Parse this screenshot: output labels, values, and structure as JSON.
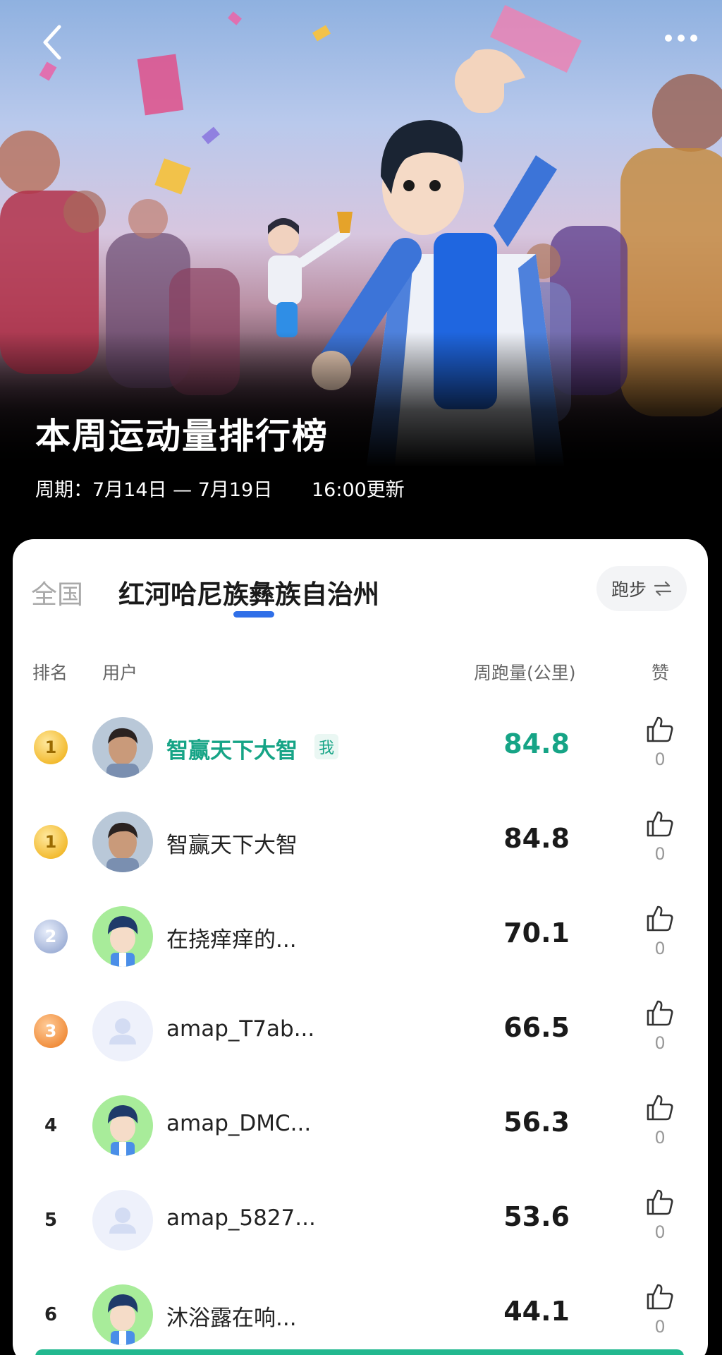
{
  "hero": {
    "title": "本周运动量排行榜",
    "period": "周期：7月14日 — 7月19日",
    "update": "16:00更新"
  },
  "tabs": {
    "national": "全国",
    "region": "红河哈尼族彝族自治州"
  },
  "sport_toggle": {
    "label": "跑步",
    "icon": "swap-arrows-icon"
  },
  "columns": {
    "rank": "排名",
    "user": "用户",
    "distance": "周跑量(公里)",
    "likes": "赞"
  },
  "me_tag": "我",
  "rows": [
    {
      "rank": "1",
      "name": "智赢天下大智",
      "distance": "84.8",
      "likes": "0"
    },
    {
      "rank": "1",
      "name": "智赢天下大智",
      "distance": "84.8",
      "likes": "0"
    },
    {
      "rank": "2",
      "name": "在挠痒痒的...",
      "distance": "70.1",
      "likes": "0"
    },
    {
      "rank": "3",
      "name": "amap_T7ab...",
      "distance": "66.5",
      "likes": "0"
    },
    {
      "rank": "4",
      "name": "amap_DMC...",
      "distance": "56.3",
      "likes": "0"
    },
    {
      "rank": "5",
      "name": "amap_5827...",
      "distance": "53.6",
      "likes": "0"
    },
    {
      "rank": "6",
      "name": "沐浴露在响...",
      "distance": "44.1",
      "likes": "0"
    }
  ],
  "colors": {
    "accent_green": "#16a486",
    "tab_blue": "#2f6fe8"
  }
}
